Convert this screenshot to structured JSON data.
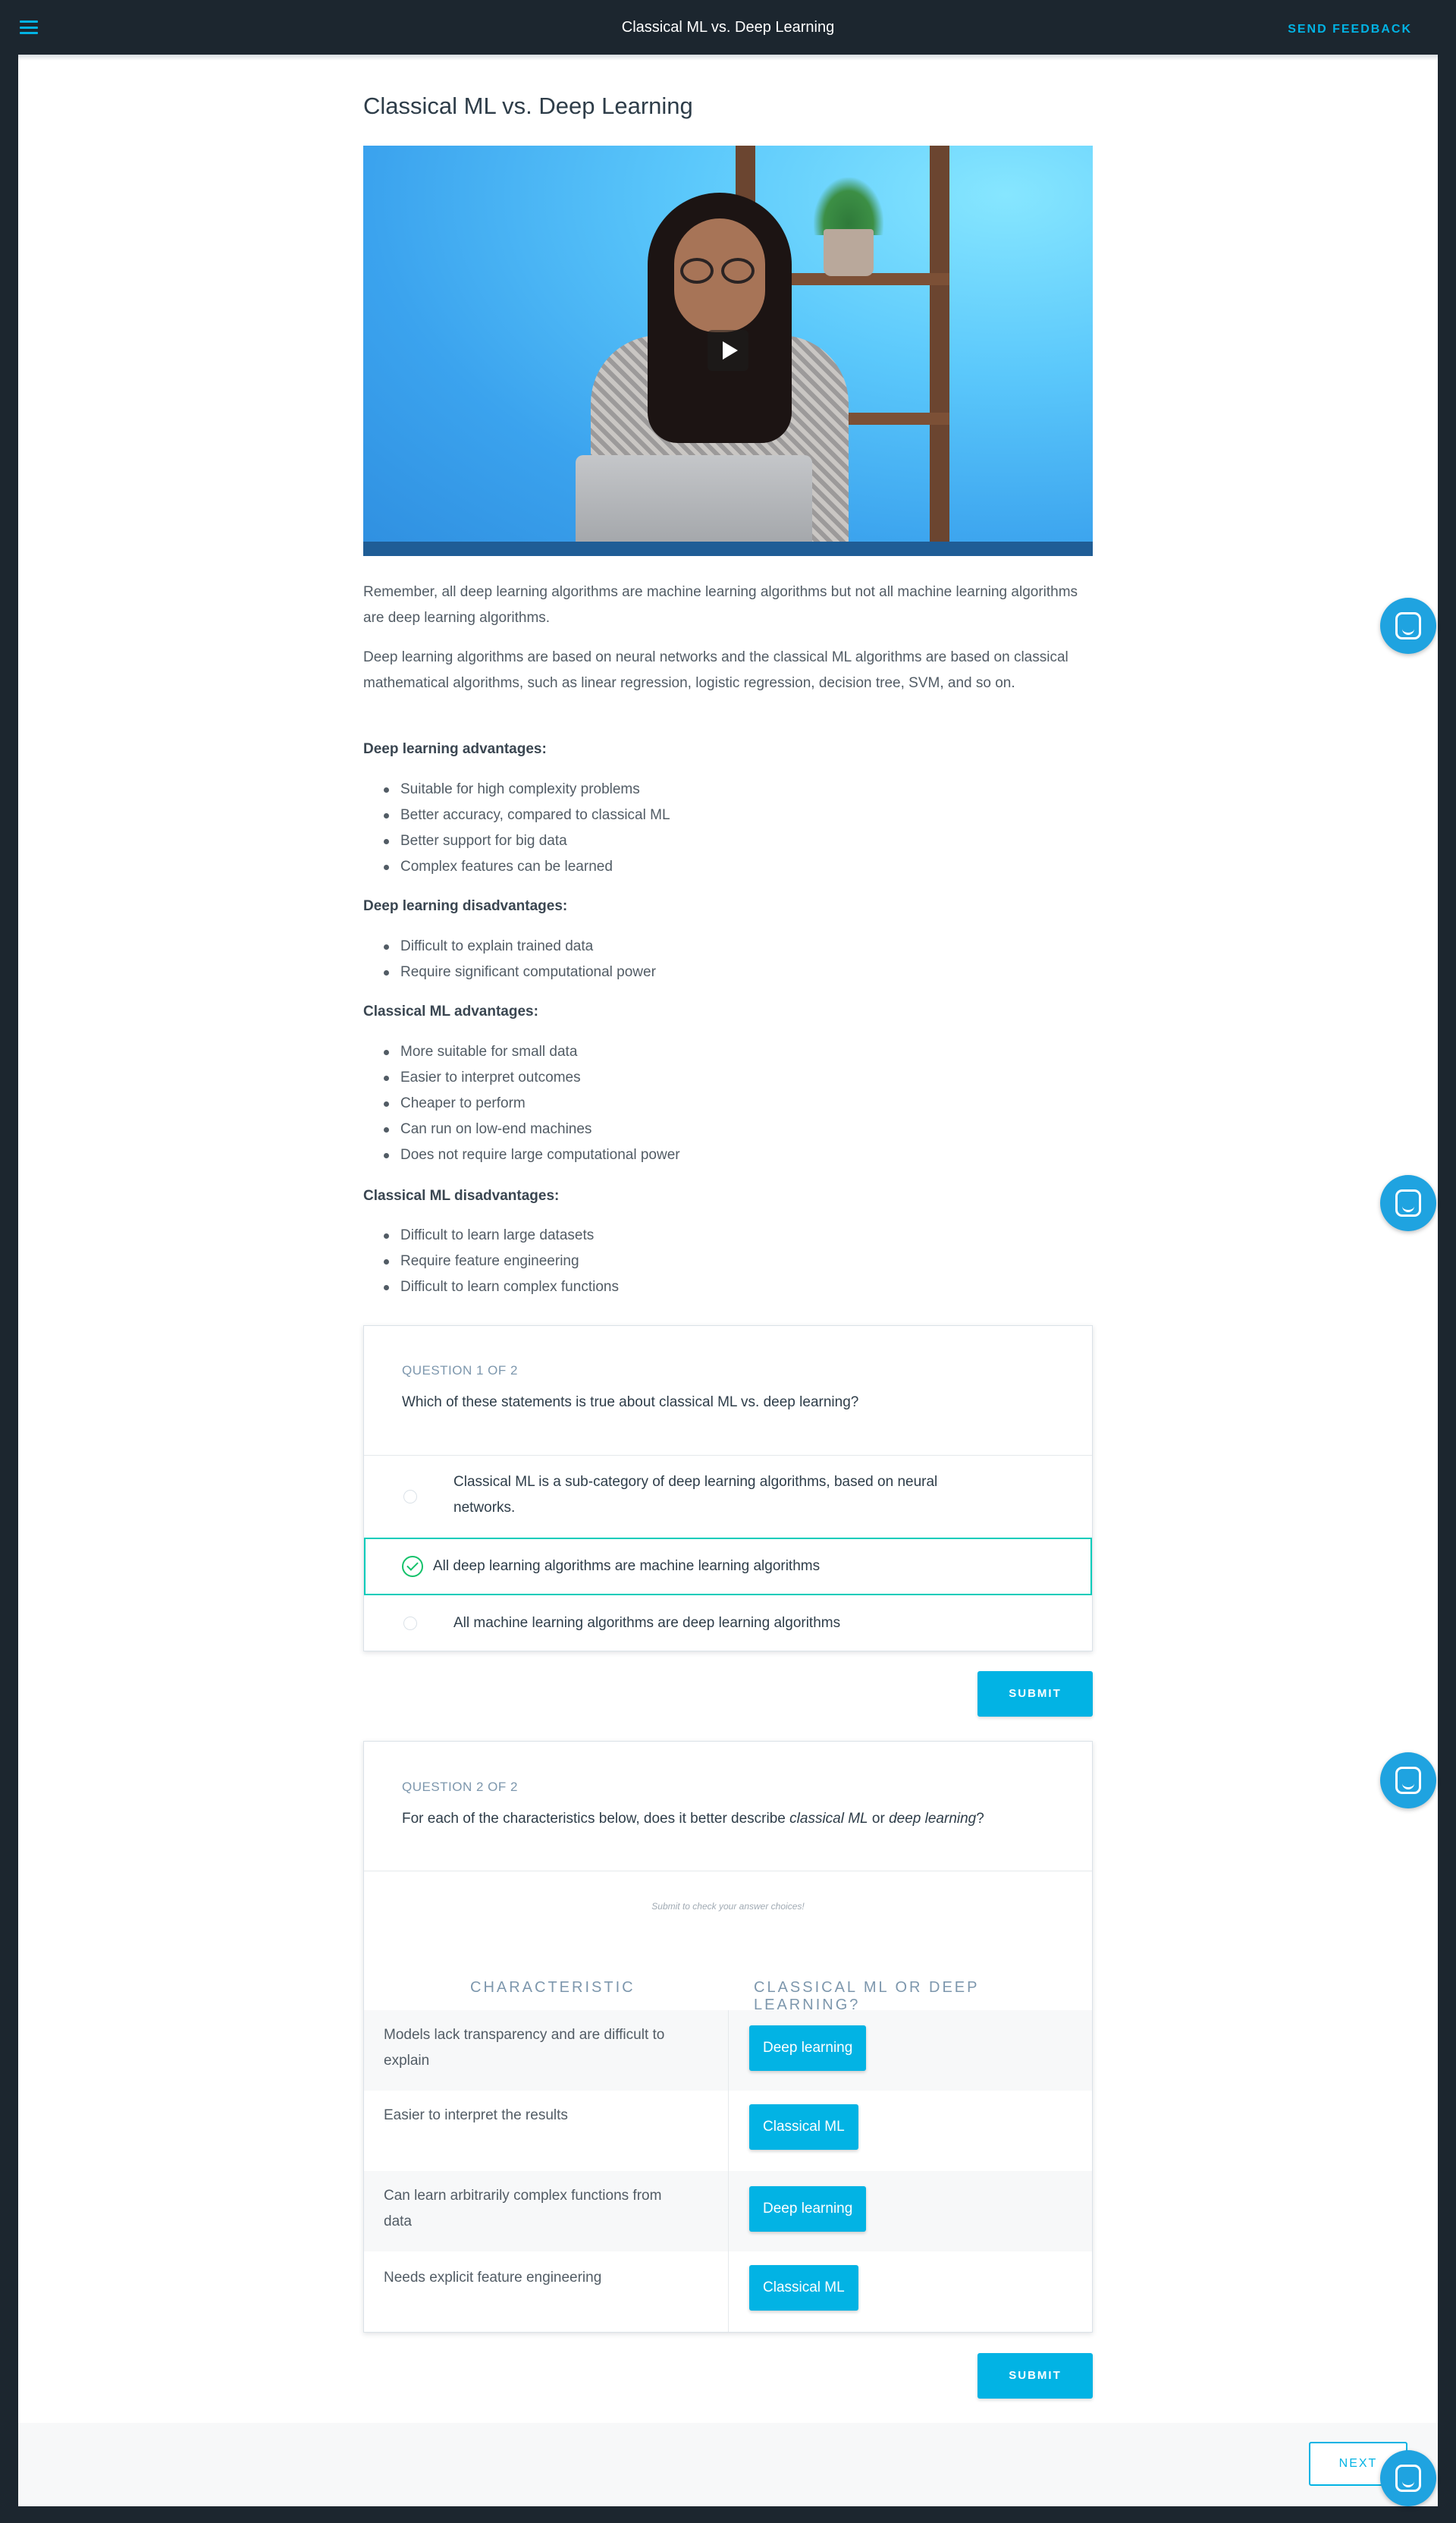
{
  "header": {
    "title": "Classical ML vs. Deep Learning",
    "send_feedback": "SEND FEEDBACK"
  },
  "page": {
    "title": "Classical ML vs. Deep Learning",
    "paragraph1": "Remember, all deep learning algorithms are machine learning algorithms but not all machine learning algorithms are deep learning algorithms.",
    "paragraph2": "Deep learning algorithms are based on neural networks and the classical ML algorithms are based on classical mathematical algorithms, such as linear regression, logistic regression, decision tree, SVM, and so on.",
    "sections": [
      {
        "heading": "Deep learning advantages:",
        "items": [
          "Suitable for high complexity problems",
          "Better accuracy, compared to classical ML",
          "Better support for big data",
          "Complex features can be learned"
        ]
      },
      {
        "heading": "Deep learning disadvantages:",
        "items": [
          "Difficult to explain trained data",
          "Require significant computational power"
        ]
      },
      {
        "heading": "Classical ML advantages:",
        "items": [
          "More suitable for small data",
          "Easier to interpret outcomes",
          "Cheaper to perform",
          "Can run on low-end machines",
          "Does not require large computational power"
        ]
      },
      {
        "heading": "Classical ML disadvantages:",
        "items": [
          "Difficult to learn large datasets",
          "Require feature engineering",
          "Difficult to learn complex functions"
        ]
      }
    ]
  },
  "question1": {
    "label": "QUESTION 1 OF 2",
    "text": "Which of these statements is true about classical ML vs. deep learning?",
    "options": [
      {
        "line1": "Classical ML is a sub-category of deep learning algorithms, based on neural",
        "line2": "networks."
      },
      {
        "line1": "All deep learning algorithms are machine learning algorithms",
        "selected": true
      },
      {
        "line1": "All machine learning algorithms are deep learning algorithms"
      }
    ],
    "submit": "SUBMIT"
  },
  "question2": {
    "label": "QUESTION 2 OF 2",
    "text_before": "For each of the characteristics below, does it better describe ",
    "text_em1": "classical ML",
    "text_mid": " or ",
    "text_em2": "deep learning",
    "text_after": "?",
    "hint": "Submit to check your answer choices!",
    "col_characteristic": "CHARACTERISTIC",
    "col_answer": "CLASSICAL ML OR DEEP LEARNING?",
    "rows": [
      {
        "line1": "Models lack transparency and are difficult to",
        "line2": "explain",
        "answer": "Deep learning"
      },
      {
        "line1": "Easier to interpret the results",
        "line2": "",
        "answer": "Classical ML"
      },
      {
        "line1": "Can learn arbitrarily complex functions from",
        "line2": "data",
        "answer": "Deep learning"
      },
      {
        "line1": "Needs explicit feature engineering",
        "line2": "",
        "answer": "Classical ML"
      }
    ],
    "submit": "SUBMIT"
  },
  "footer": {
    "next": "NEXT"
  },
  "colors": {
    "accent": "#02b3e4",
    "header_bg": "#1c262f",
    "correct": "#15c26b",
    "chat_bubble": "#1fa3e0"
  }
}
